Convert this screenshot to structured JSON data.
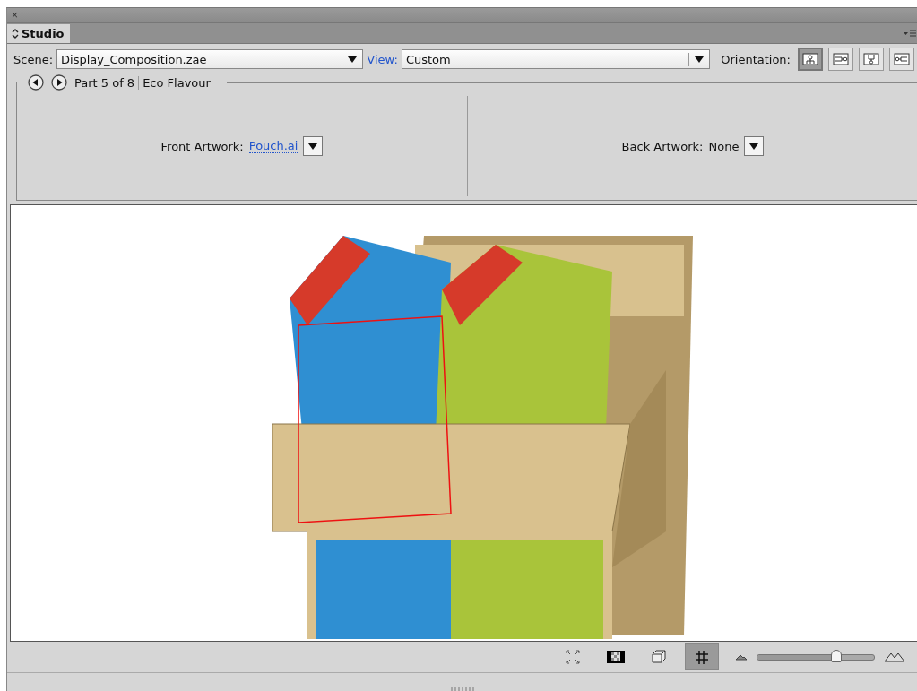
{
  "panel": {
    "close": "×",
    "tab": {
      "label": "Studio",
      "selected": true
    }
  },
  "scene": {
    "label": "Scene:",
    "value": "Display_Composition.zae"
  },
  "view": {
    "label": "View:",
    "value": "Custom"
  },
  "orientation": {
    "label": "Orientation:",
    "options": [
      {
        "selected": true
      },
      {
        "selected": false
      },
      {
        "selected": false
      },
      {
        "selected": false
      }
    ]
  },
  "part": {
    "counter": "Part 5 of 8",
    "name": "Eco Flavour"
  },
  "front_artwork": {
    "label": "Front Artwork:",
    "value": "Pouch.ai"
  },
  "back_artwork": {
    "label": "Back Artwork:",
    "value": "None"
  },
  "toolbar": {
    "tools": [
      {
        "kind": "fit",
        "selected": false
      },
      {
        "kind": "checker",
        "selected": false
      },
      {
        "kind": "cube",
        "selected": false
      },
      {
        "kind": "grid",
        "selected": true
      }
    ],
    "zoom": {
      "level": 0.68
    }
  }
}
